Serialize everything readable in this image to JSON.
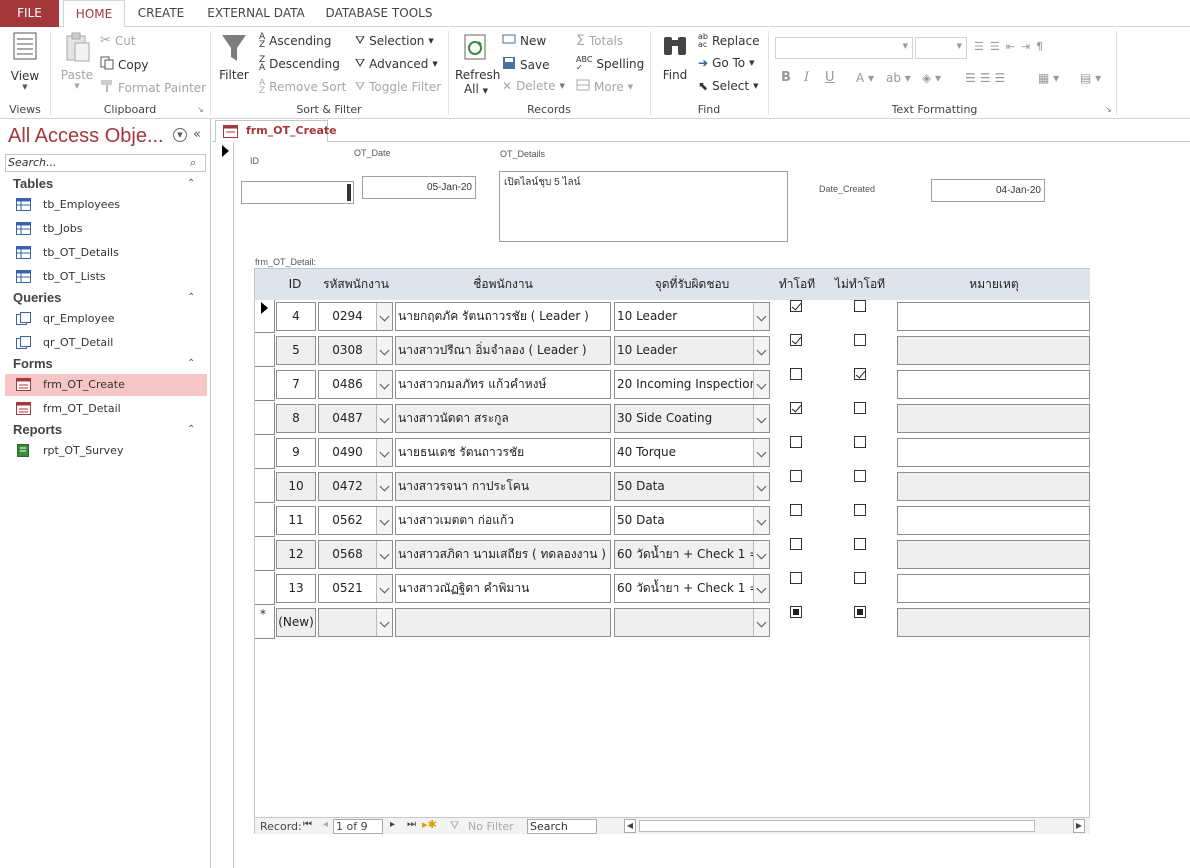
{
  "ribbon_tabs": {
    "file": "FILE",
    "home": "HOME",
    "create": "CREATE",
    "external": "EXTERNAL DATA",
    "database": "DATABASE TOOLS"
  },
  "groups": {
    "views": "Views",
    "clipboard": "Clipboard",
    "sort_filter": "Sort & Filter",
    "records": "Records",
    "find": "Find",
    "text_formatting": "Text Formatting"
  },
  "buttons": {
    "view": "View",
    "paste": "Paste",
    "cut": "Cut",
    "copy": "Copy",
    "format_painter": "Format Painter",
    "filter": "Filter",
    "ascending": "Ascending",
    "descending": "Descending",
    "remove_sort": "Remove Sort",
    "selection": "Selection",
    "advanced": "Advanced",
    "toggle_filter": "Toggle Filter",
    "refresh_all_1": "Refresh",
    "refresh_all_2": "All",
    "new": "New",
    "save": "Save",
    "delete": "Delete",
    "totals": "Totals",
    "spelling": "Spelling",
    "more": "More",
    "find": "Find",
    "replace": "Replace",
    "go_to": "Go To",
    "select": "Select",
    "bold": "B",
    "italic": "I",
    "underline": "U"
  },
  "nav": {
    "title": "All Access Obje...",
    "search_placeholder": "Search...",
    "sections": [
      {
        "label": "Tables",
        "items": [
          "tb_Employees",
          "tb_Jobs",
          "tb_OT_Details",
          "tb_OT_Lists"
        ]
      },
      {
        "label": "Queries",
        "items": [
          "qr_Employee",
          "qr_OT_Detail"
        ]
      },
      {
        "label": "Forms",
        "items": [
          "frm_OT_Create",
          "frm_OT_Detail"
        ]
      },
      {
        "label": "Reports",
        "items": [
          "rpt_OT_Survey"
        ]
      }
    ],
    "selected": "frm_OT_Create"
  },
  "doc_tab": "frm_OT_Create",
  "form": {
    "id_label": "ID",
    "id_value": "",
    "ot_date_label": "OT_Date",
    "ot_date_value": "05-Jan-20",
    "ot_details_label": "OT_Details",
    "ot_details_value": "เปิดไลน์ชุบ 5 ไลน์",
    "date_created_label": "Date_Created",
    "date_created_value": "04-Jan-20",
    "subform_label": "frm_OT_Detail:"
  },
  "subform": {
    "headers": [
      "ID",
      "รหัสพนักงาน",
      "ชื่อพนักงาน",
      "จุดที่รับผิดชอบ",
      "ทำโอที",
      "ไม่ทำโอที",
      "หมายเหตุ"
    ],
    "rows": [
      {
        "id": "4",
        "code": "0294",
        "name": "นายกฤตภัค  รัตนถาวรชัย ( Leader )",
        "point": "10 Leader",
        "ot": true,
        "no_ot": false,
        "note": ""
      },
      {
        "id": "5",
        "code": "0308",
        "name": "นางสาวปรีณา  อิ่มจำลอง ( Leader )",
        "point": "10 Leader",
        "ot": true,
        "no_ot": false,
        "note": ""
      },
      {
        "id": "7",
        "code": "0486",
        "name": "นางสาวกมลภัทร แก้วคำหงษ์",
        "point": "20 Incoming Inspection",
        "ot": false,
        "no_ot": true,
        "note": ""
      },
      {
        "id": "8",
        "code": "0487",
        "name": "นางสาวนัดดา  สระกูล",
        "point": "30 Side Coating",
        "ot": true,
        "no_ot": false,
        "note": ""
      },
      {
        "id": "9",
        "code": "0490",
        "name": "นายธนเดช  รัตนถาวรชัย",
        "point": "40 Torque",
        "ot": false,
        "no_ot": false,
        "note": ""
      },
      {
        "id": "10",
        "code": "0472",
        "name": "นางสาวรจนา กาประโคน",
        "point": "50 Data",
        "ot": false,
        "no_ot": false,
        "note": ""
      },
      {
        "id": "11",
        "code": "0562",
        "name": "นางสาวเมตตา  ก่อแก้ว",
        "point": "50 Data",
        "ot": false,
        "no_ot": false,
        "note": ""
      },
      {
        "id": "12",
        "code": "0568",
        "name": "นางสาวสภิดา นามเสถียร ( ทดลองงาน )",
        "point": "60 วัดน้ำยา + Check 1 =",
        "ot": false,
        "no_ot": false,
        "note": ""
      },
      {
        "id": "13",
        "code": "0521",
        "name": "นางสาวณัฏฐิดา  คำพิมาน",
        "point": "60 วัดน้ำยา + Check 1 =",
        "ot": false,
        "no_ot": false,
        "note": ""
      }
    ],
    "new_row_label": "(New)",
    "new_row_marker": "*"
  },
  "record_nav": {
    "label": "Record:",
    "position": "1 of 9",
    "no_filter": "No Filter",
    "search": "Search"
  },
  "colors": {
    "accent": "#a4373a",
    "header_bg": "#dfe3ec",
    "selected_nav": "#f6c6c7"
  }
}
